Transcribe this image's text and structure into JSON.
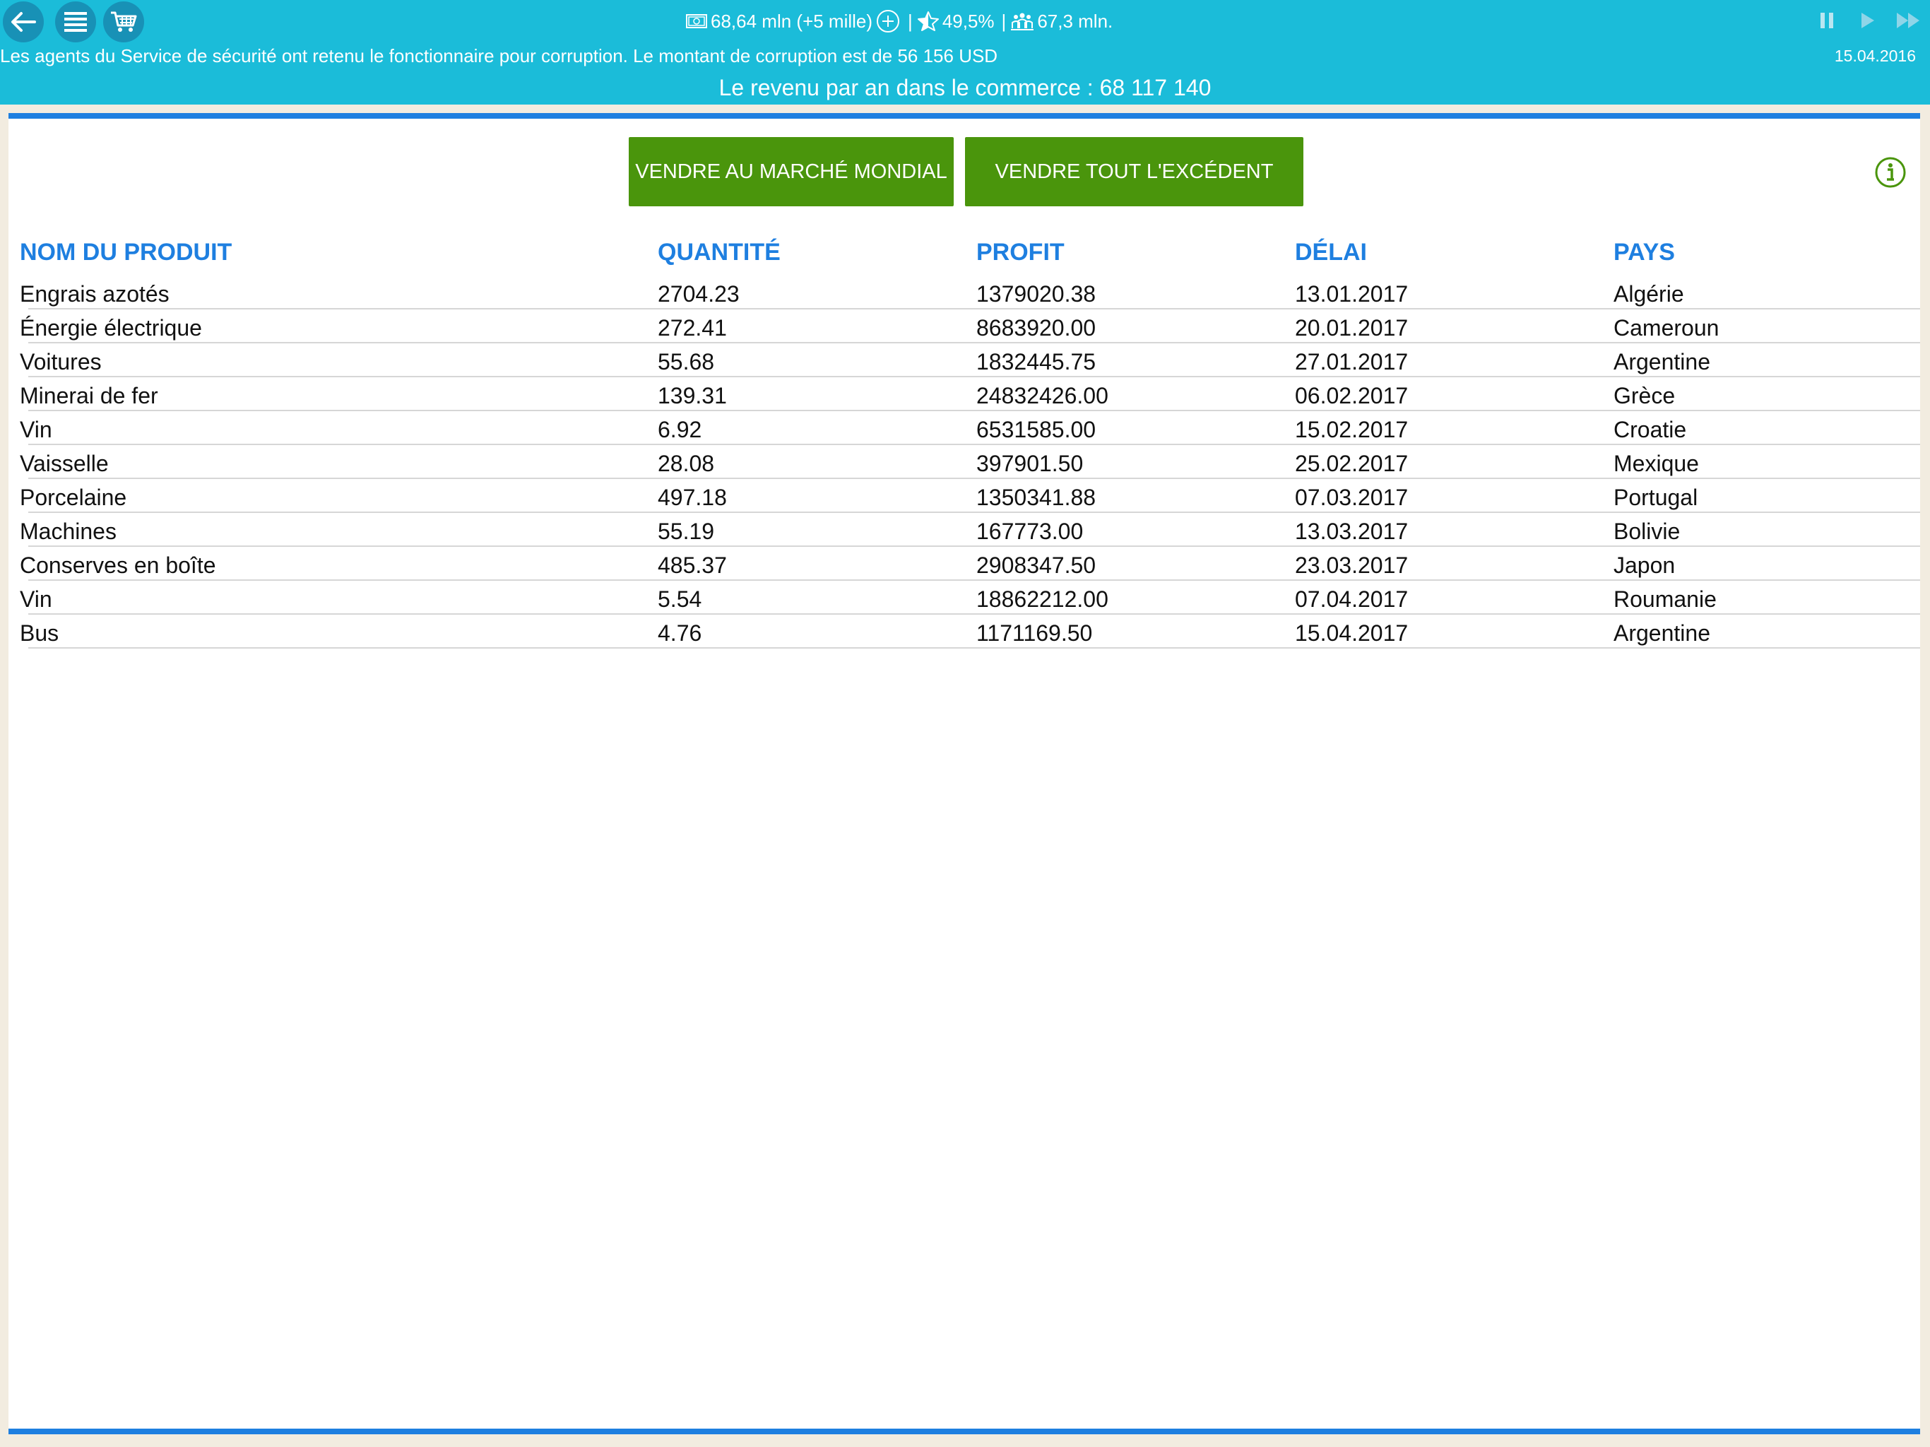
{
  "topbar": {
    "nav_icons": [
      "back-arrow-icon",
      "menu-icon",
      "cart-icon"
    ],
    "stats": {
      "money": "68,64 mln (+5 mille)",
      "rating": "49,5%",
      "population": "67,3 mln."
    },
    "news": "Les agents du Service de sécurité ont retenu le fonctionnaire pour corruption. Le montant de corruption est de 56 156 USD",
    "date": "15.04.2016",
    "revenue": "Le revenu par an dans le commerce : 68 117 140",
    "controls": [
      "pause-icon",
      "play-icon",
      "fast-forward-icon"
    ]
  },
  "actions": {
    "sell_world": "VENDRE AU MARCHÉ MONDIAL",
    "sell_surplus": "VENDRE TOUT L'EXCÉDENT"
  },
  "table": {
    "headers": [
      "NOM DU PRODUIT",
      "QUANTITÉ",
      "PROFIT",
      "DÉLAI",
      "PAYS"
    ],
    "rows": [
      [
        "Engrais azotés",
        "2704.23",
        "1379020.38",
        "13.01.2017",
        "Algérie"
      ],
      [
        "Énergie électrique",
        "272.41",
        "8683920.00",
        "20.01.2017",
        "Cameroun"
      ],
      [
        "Voitures",
        "55.68",
        "1832445.75",
        "27.01.2017",
        "Argentine"
      ],
      [
        "Minerai de fer",
        "139.31",
        "24832426.00",
        "06.02.2017",
        "Grèce"
      ],
      [
        "Vin",
        "6.92",
        "6531585.00",
        "15.02.2017",
        "Croatie"
      ],
      [
        "Vaisselle",
        "28.08",
        "397901.50",
        "25.02.2017",
        "Mexique"
      ],
      [
        "Porcelaine",
        "497.18",
        "1350341.88",
        "07.03.2017",
        "Portugal"
      ],
      [
        "Machines",
        "55.19",
        "167773.00",
        "13.03.2017",
        "Bolivie"
      ],
      [
        "Conserves en boîte",
        "485.37",
        "2908347.50",
        "23.03.2017",
        "Japon"
      ],
      [
        "Vin",
        "5.54",
        "18862212.00",
        "07.04.2017",
        "Roumanie"
      ],
      [
        "Bus",
        "4.76",
        "1171169.50",
        "15.04.2017",
        "Argentine"
      ]
    ]
  },
  "colors": {
    "topbar": "#1bbcd9",
    "round_button": "#1891b6",
    "accent_blue": "#1e7fe0",
    "action_green": "#4a950c",
    "page_background": "#f2ece0"
  }
}
